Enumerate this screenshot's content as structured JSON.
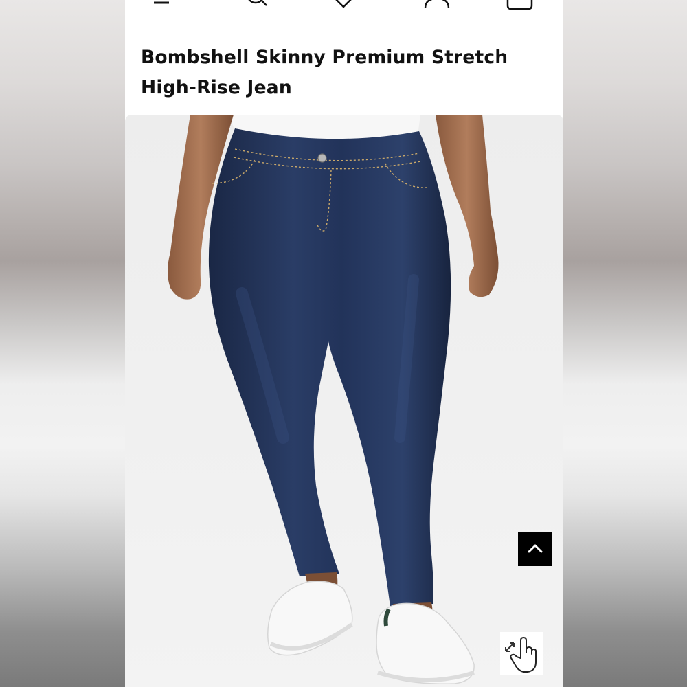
{
  "header": {
    "icons": [
      "menu-icon",
      "search-icon",
      "heart-icon",
      "account-icon",
      "bag-icon"
    ]
  },
  "product": {
    "title": "Bombshell Skinny Premium Stretch High-Rise Jean"
  },
  "colors": {
    "denim": "#1f2f52",
    "background": "#ececec",
    "accent": "#000000"
  },
  "controls": {
    "back_to_top_icon": "chevron-up-icon",
    "zoom_hint_icon": "tap-zoom-hand-icon"
  }
}
